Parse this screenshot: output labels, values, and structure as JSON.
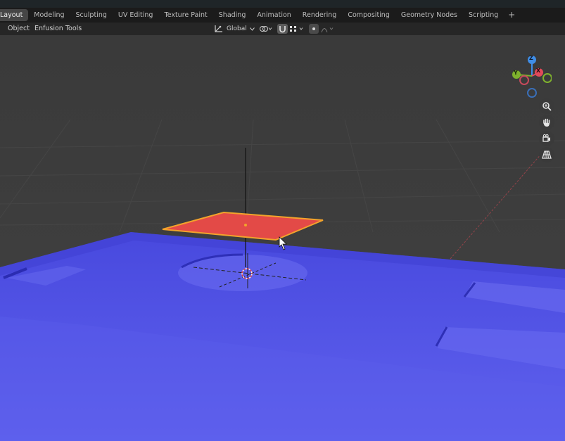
{
  "workspace_tabs": [
    "Layout",
    "Modeling",
    "Sculpting",
    "UV Editing",
    "Texture Paint",
    "Shading",
    "Animation",
    "Rendering",
    "Compositing",
    "Geometry Nodes",
    "Scripting"
  ],
  "header": {
    "menus": [
      "Object",
      "Enfusion Tools"
    ],
    "transform_orientation": "Global"
  },
  "gizmo": {
    "z": "Z",
    "y": "Y",
    "x": "X"
  },
  "icons": {
    "add_workspace": "plus-icon",
    "pivot": "pivot-icon",
    "link": "link-icon",
    "snap": "magnet-icon",
    "snap_target": "grid-snap-icon",
    "proportional": "proportional-icon",
    "falloff": "falloff-curve-icon",
    "zoom": "zoom-icon",
    "pan": "hand-icon",
    "camera": "camera-icon",
    "perspective": "grid-perspective-icon"
  },
  "colors": {
    "viewport_bg": "#3d3d3d",
    "blue_mesh": "#4d4fe0",
    "selected_plane": "#e34a47",
    "selection_outline": "#f3a32b",
    "axis_x": "#e24a5a",
    "axis_y": "#7fb22d",
    "axis_z": "#3f8ee8"
  }
}
